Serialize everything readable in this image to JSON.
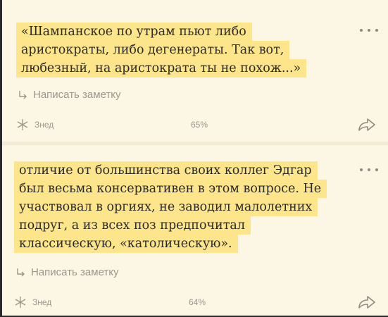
{
  "cards": [
    {
      "quote_lines": [
        "«Шампанское по утрам пьют либо",
        "аристократы, либо дегенераты. Так вот,",
        "любезный, на аристократа ты не похож...»"
      ],
      "note_label": "Написать заметку",
      "author": "Знед",
      "progress": "65%"
    },
    {
      "quote_lines": [
        "отличие от большинства своих коллег Эдгар",
        "был весьма консервативен в этом вопросе. Не",
        "участвовал в оргиях, не заводил малолетних",
        "подруг, а из всех поз предпочитал",
        "классическую, «католическую»."
      ],
      "note_label": "Написать заметку",
      "author": "Знед",
      "progress": "64%"
    }
  ],
  "colors": {
    "highlight": "#fde58b",
    "background": "#fcf6e4",
    "muted": "#9a968b"
  },
  "icons": [
    "more-dots-icon",
    "reply-arrow-icon",
    "star-icon",
    "share-icon"
  ]
}
